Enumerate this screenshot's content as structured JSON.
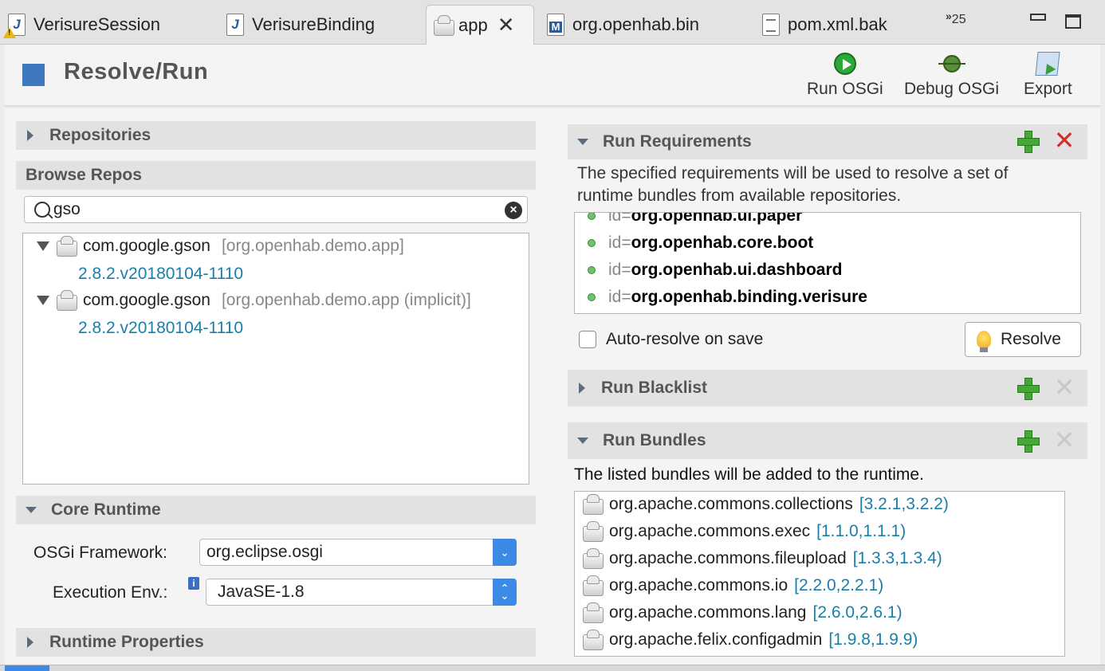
{
  "tabs": [
    {
      "label": "VerisureSession",
      "icon": "java-file-warning-icon"
    },
    {
      "label": "VerisureBinding",
      "icon": "java-file-icon"
    },
    {
      "label": "app",
      "icon": "bndrun-icon",
      "active": true
    },
    {
      "label": "org.openhab.bin",
      "icon": "maven-file-icon"
    },
    {
      "label": "pom.xml.bak",
      "icon": "text-file-icon"
    }
  ],
  "tab_overflow": {
    "chevron": "»",
    "count": "25"
  },
  "header": {
    "title": "Resolve/Run",
    "tools": [
      {
        "label": "Run OSGi",
        "icon": "run-icon"
      },
      {
        "label": "Debug OSGi",
        "icon": "debug-icon"
      },
      {
        "label": "Export",
        "icon": "export-icon"
      }
    ]
  },
  "left": {
    "repositories_title": "Repositories",
    "browse_title": "Browse Repos",
    "search_value": "gso",
    "tree": [
      {
        "name": "com.google.gson",
        "source": "[org.openhab.demo.app]",
        "version": "2.8.2.v20180104-1110"
      },
      {
        "name": "com.google.gson",
        "source": "[org.openhab.demo.app (implicit)]",
        "version": "2.8.2.v20180104-1110"
      }
    ],
    "core_runtime_title": "Core Runtime",
    "framework_label": "OSGi Framework:",
    "framework_value": "org.eclipse.osgi",
    "env_label": "Execution Env.:",
    "env_value": "JavaSE-1.8",
    "info_glyph": "i",
    "runtime_props_title": "Runtime Properties"
  },
  "right": {
    "run_requirements_title": "Run Requirements",
    "run_requirements_desc_1": "The specified requirements will be used to resolve a set of",
    "run_requirements_desc_2": "runtime bundles from available repositories.",
    "requirements": [
      {
        "prefix": "id=",
        "name": "org.openhab.ui.paper"
      },
      {
        "prefix": "id=",
        "name": "org.openhab.core.boot"
      },
      {
        "prefix": "id=",
        "name": "org.openhab.ui.dashboard"
      },
      {
        "prefix": "id=",
        "name": "org.openhab.binding.verisure"
      }
    ],
    "auto_resolve_label": "Auto-resolve on save",
    "resolve_label": "Resolve",
    "run_blacklist_title": "Run Blacklist",
    "run_bundles_title": "Run Bundles",
    "run_bundles_desc": "The listed bundles will be added to the runtime.",
    "bundles": [
      {
        "name": "org.apache.commons.collections",
        "range": "[3.2.1,3.2.2)"
      },
      {
        "name": "org.apache.commons.exec",
        "range": "[1.1.0,1.1.1)"
      },
      {
        "name": "org.apache.commons.fileupload",
        "range": "[1.3.3,1.3.4)"
      },
      {
        "name": "org.apache.commons.io",
        "range": "[2.2.0,2.2.1)"
      },
      {
        "name": "org.apache.commons.lang",
        "range": "[2.6.0,2.6.1)"
      },
      {
        "name": "org.apache.felix.configadmin",
        "range": "[1.9.8,1.9.9)"
      }
    ]
  },
  "colors": {
    "accent": "#3d77bd",
    "link": "#1a7fa8",
    "add": "#44a836",
    "remove": "#d62b2b"
  }
}
